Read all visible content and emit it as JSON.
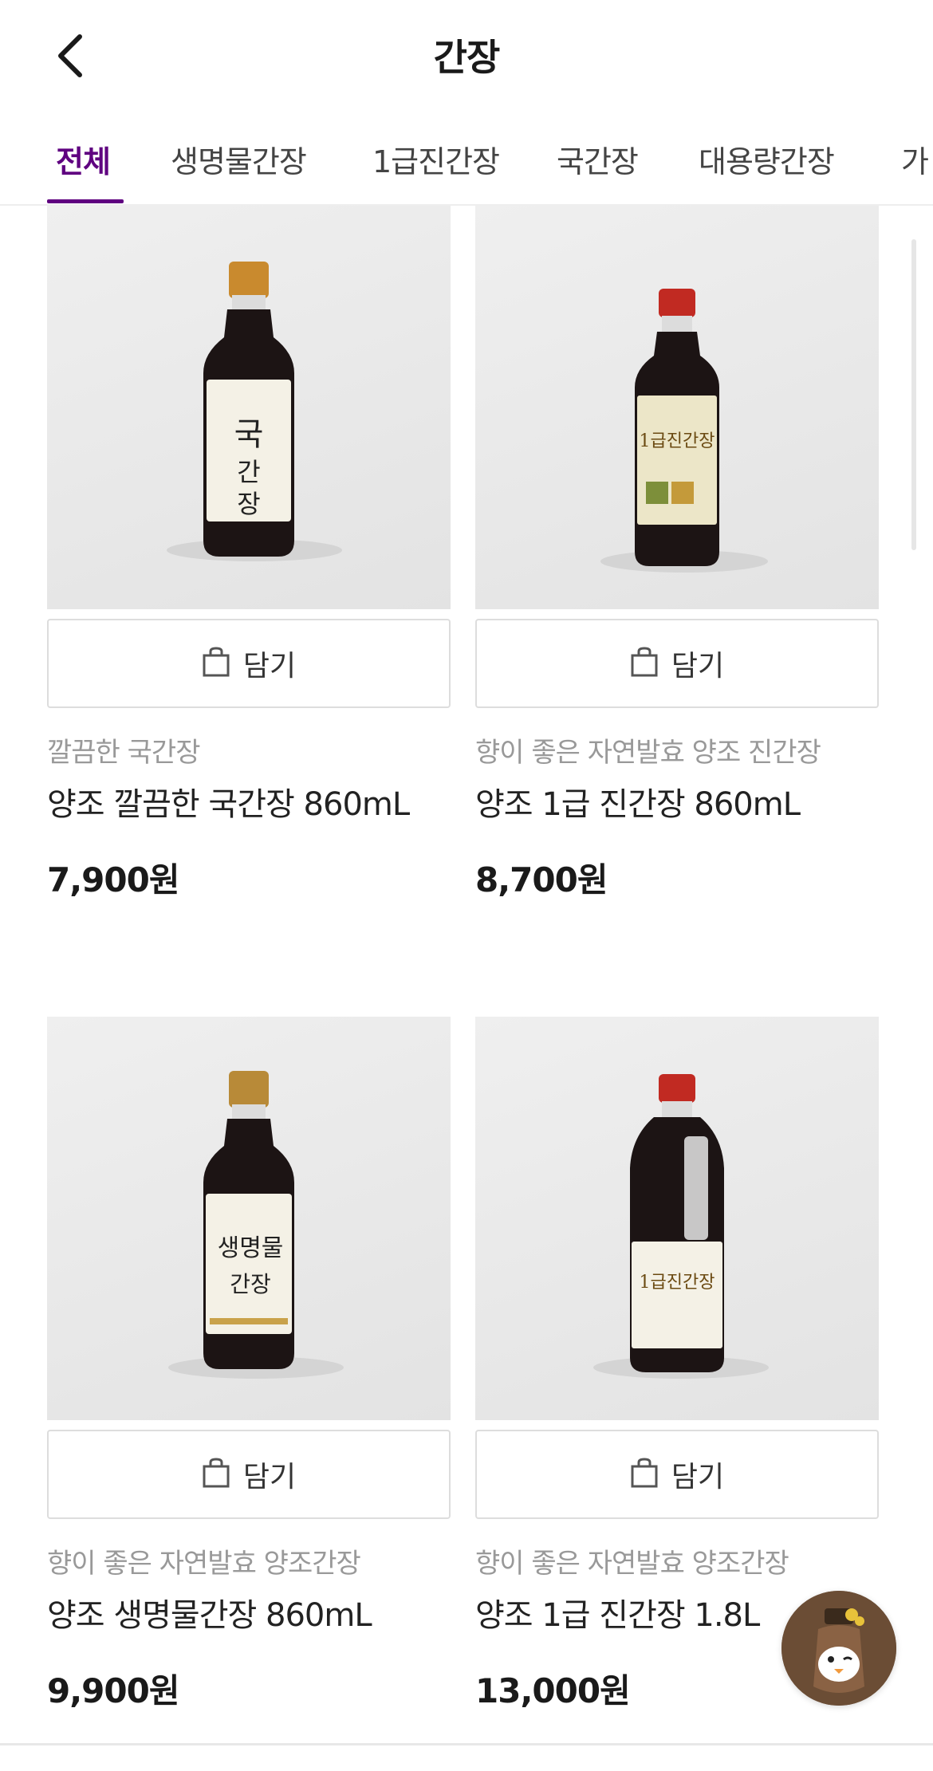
{
  "header": {
    "title": "간장",
    "back_icon": "chevron-left-icon"
  },
  "tabs": [
    {
      "label": "전체",
      "active": true
    },
    {
      "label": "생명물간장",
      "active": false
    },
    {
      "label": "1급진간장",
      "active": false
    },
    {
      "label": "국간장",
      "active": false
    },
    {
      "label": "대용량간장",
      "active": false
    },
    {
      "label": "가",
      "active": false
    }
  ],
  "colors": {
    "accent": "#5f0080",
    "price": "#1a1a1a",
    "subtitle": "#999999"
  },
  "products": [
    {
      "subtitle": "깔끔한 국간장",
      "name": "양조 깔끔한 국간장 860mL",
      "price": "7,900원",
      "cart_label": "담기",
      "cap": "gold"
    },
    {
      "subtitle": "향이 좋은 자연발효 양조 진간장",
      "name": "양조 1급 진간장 860mL",
      "price": "8,700원",
      "cart_label": "담기",
      "cap": "red"
    },
    {
      "subtitle": "향이 좋은 자연발효 양조간장",
      "name": "양조 생명물간장 860mL",
      "price": "9,900원",
      "cart_label": "담기",
      "cap": "gold"
    },
    {
      "subtitle": "향이 좋은 자연발효 양조간장",
      "name": "양조 1급 진간장 1.8L",
      "price": "13,000원",
      "cart_label": "담기",
      "cap": "red"
    }
  ],
  "fab": {
    "icon": "mascot-chat-icon"
  }
}
